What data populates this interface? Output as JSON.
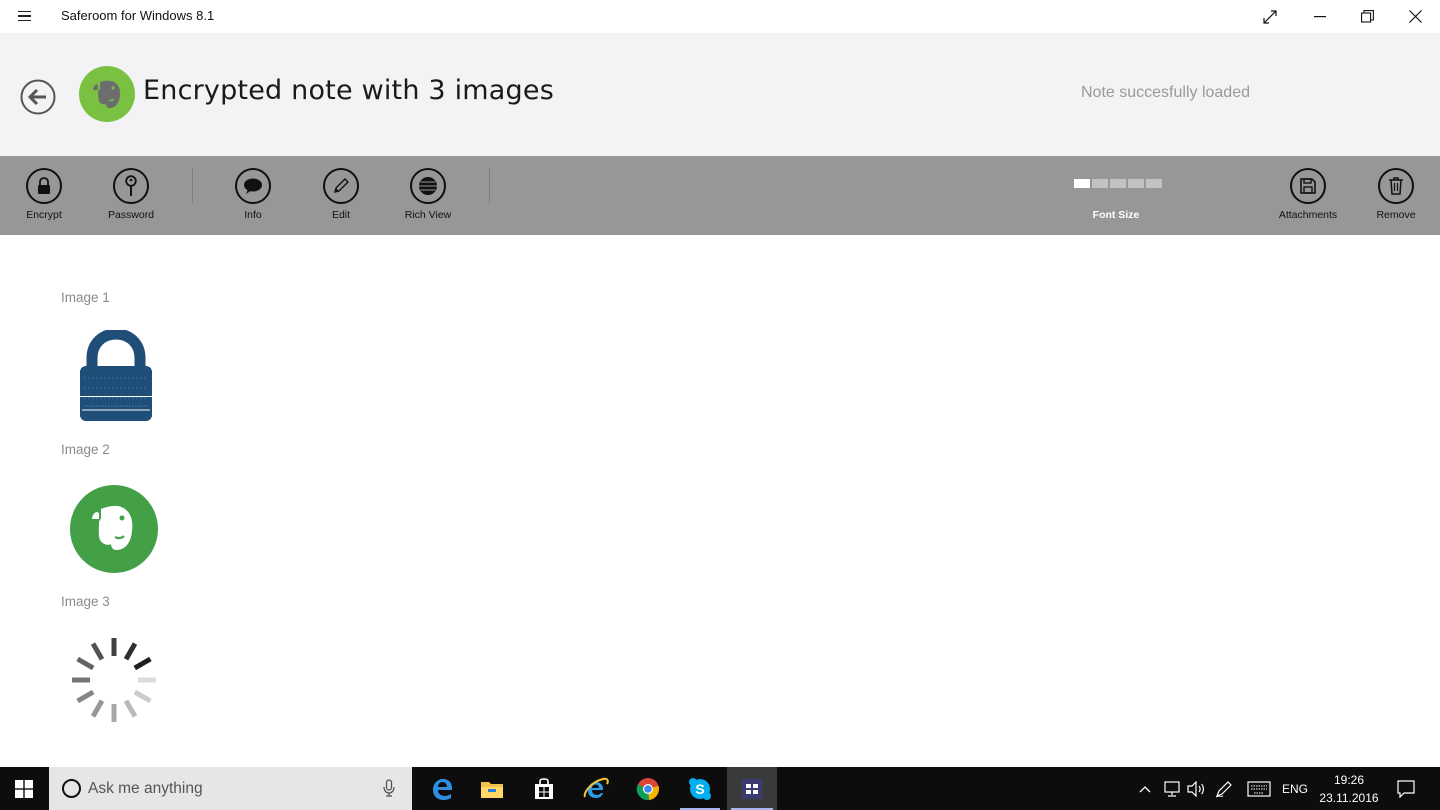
{
  "window": {
    "title": "Saferoom for Windows 8.1",
    "controls": [
      "fullscreen-icon",
      "minimize-icon",
      "restore-icon",
      "close-icon"
    ]
  },
  "header": {
    "note_title": "Encrypted note with 3 images",
    "status": "Note succesfully loaded",
    "avatar_icon": "evernote-elephant-icon",
    "avatar_color": "#7ac142"
  },
  "toolbar": {
    "encrypt": "Encrypt",
    "password": "Password",
    "info": "Info",
    "edit": "Edit",
    "rich_view": "Rich View",
    "font_size": "Font Size",
    "font_size_level": 1,
    "font_size_steps": 5,
    "attachments": "Attachments",
    "remove": "Remove"
  },
  "images": [
    {
      "label": "Image 1",
      "icon": "protected-image-lock-icon",
      "color": "#1f4e79"
    },
    {
      "label": "Image 2",
      "icon": "evernote-logo-icon",
      "color": "#43a047"
    },
    {
      "label": "Image 3",
      "icon": "loading-spinner-icon"
    }
  ],
  "taskbar": {
    "search_placeholder": "Ask me anything",
    "apps": [
      "edge-icon",
      "file-explorer-icon",
      "store-icon",
      "internet-explorer-icon",
      "chrome-icon",
      "skype-icon",
      "saferoom-icon"
    ],
    "language": "ENG",
    "time": "19:26",
    "date": "23.11.2016"
  }
}
